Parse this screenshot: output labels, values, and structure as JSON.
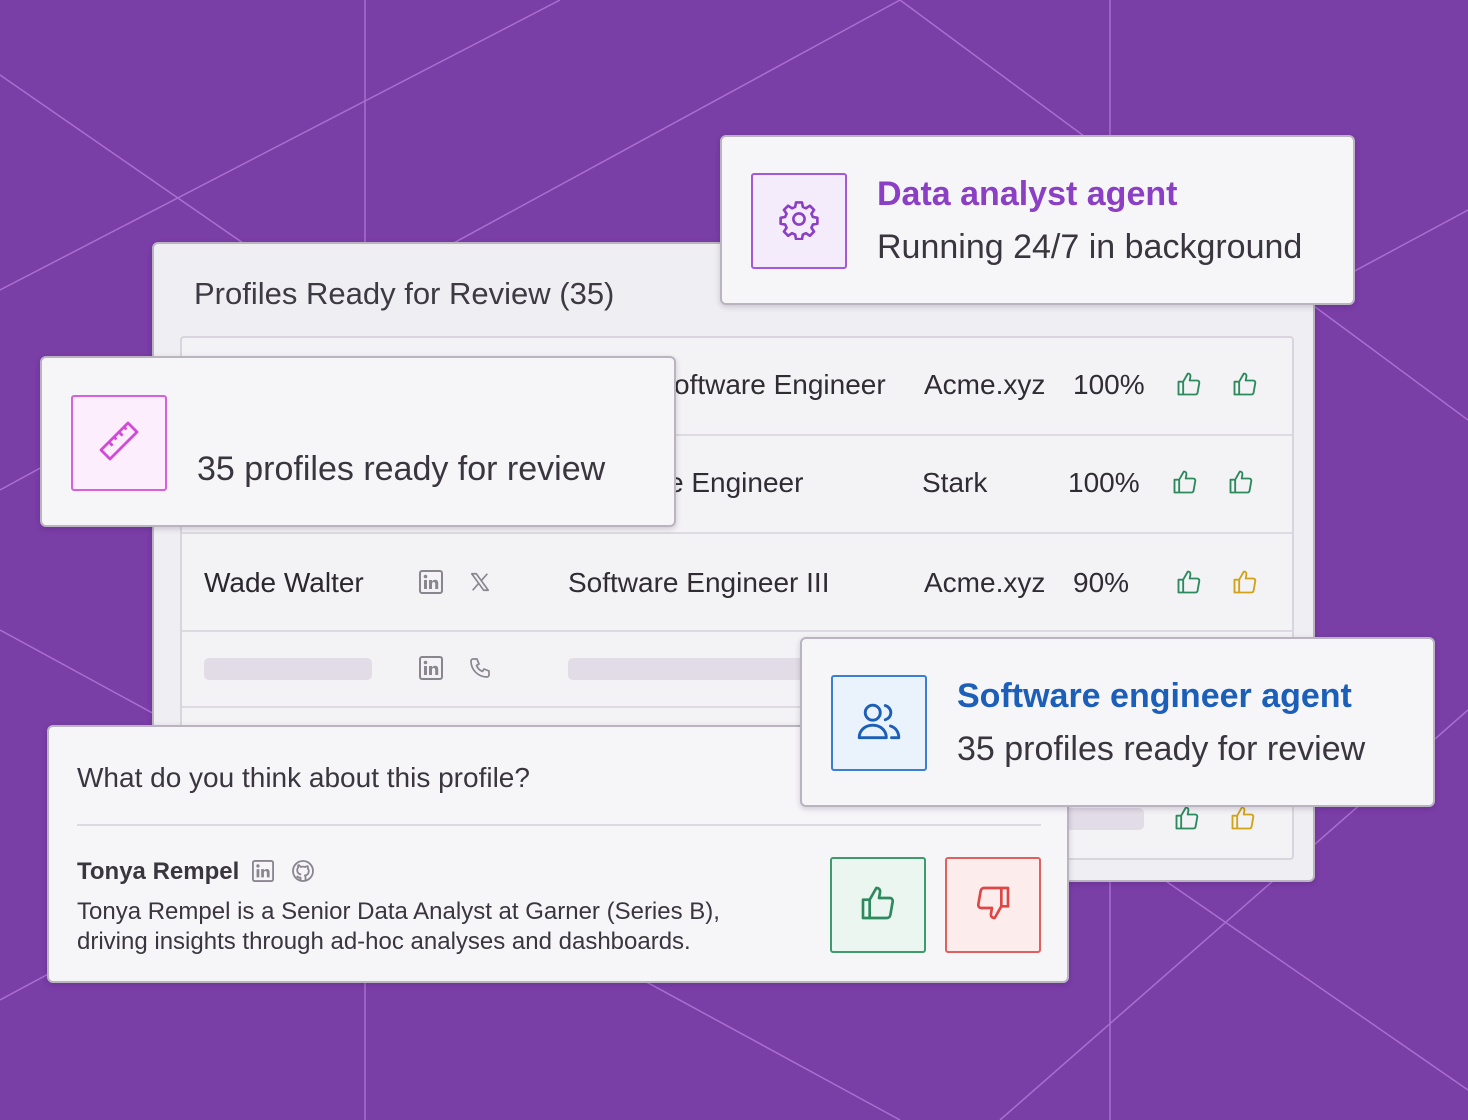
{
  "colors": {
    "background": "#7a3ea7",
    "purple_accent": "#8a3fc4",
    "blue_accent": "#1c5fb8",
    "pink_accent": "#d24bd8",
    "thumb_green": "#2d8a5e",
    "thumb_yellow": "#d1a318",
    "dislike_red": "#de4646"
  },
  "review_panel": {
    "title": "Profiles Ready for Review (35)",
    "rows": [
      {
        "name": "",
        "title": "Software Engineer",
        "company": "Acme.xyz",
        "score": "100%",
        "icons": [
          "thumbs-up-green",
          "thumbs-up-green"
        ]
      },
      {
        "name": "",
        "title": "Software Engineer",
        "company": "Stark",
        "score": "100%",
        "icons": [
          "thumbs-up-green",
          "thumbs-up-green"
        ]
      },
      {
        "name": "Wade Walter",
        "social": [
          "linkedin-icon",
          "x-icon"
        ],
        "title": "Software Engineer III",
        "company": "Acme.xyz",
        "score": "90%",
        "icons": [
          "thumbs-up-green",
          "thumbs-up-yellow"
        ]
      },
      {
        "name": "",
        "social": [
          "linkedin-icon",
          "phone-icon"
        ],
        "placeholder": true
      }
    ],
    "partial_first_title": "oftware Engineer",
    "partial_second_title": "e Engineer"
  },
  "data_analyst_card": {
    "icon": "gear-icon",
    "title": "Data analyst agent",
    "subtitle": "Running 24/7 in background"
  },
  "ruler_card": {
    "icon": "ruler-icon",
    "text": "35 profiles ready for review"
  },
  "software_agent_card": {
    "icon": "users-icon",
    "title": "Software engineer agent",
    "subtitle": "35 profiles ready for review"
  },
  "feedback_card": {
    "question": "What do you think about this profile?",
    "person_name": "Tonya Rempel",
    "person_icons": [
      "linkedin-icon",
      "github-icon"
    ],
    "description_line1": "Tonya Rempel is a Senior Data Analyst at Garner (Series B),",
    "description_line2": "driving insights through ad-hoc analyses and dashboards.",
    "like_icon": "thumbs-up-icon",
    "dislike_icon": "thumbs-down-icon"
  }
}
